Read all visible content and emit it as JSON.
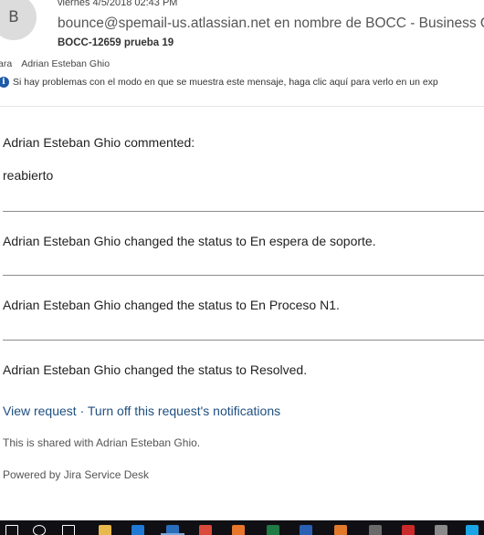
{
  "email": {
    "avatar_letter": "B",
    "date": "viernes 4/5/2018 02:43 PM",
    "sender": "bounce@spemail-us.atlassian.net en nombre de BOCC - Business Operat",
    "subject": "BOCC-12659 prueba 19",
    "to_label": "ara",
    "to_recipient": "Adrian Esteban Ghio",
    "info_text": "Si hay problemas con el modo en que se muestra este mensaje, haga clic aquí para verlo en un exp"
  },
  "body": {
    "comment_header": "Adrian Esteban Ghio commented:",
    "comment_text": "reabierto",
    "status_changes": [
      "Adrian Esteban Ghio changed the status to En espera de soporte.",
      "Adrian Esteban Ghio changed the status to En Proceso N1.",
      "Adrian Esteban Ghio changed the status to Resolved."
    ],
    "view_request": "View request",
    "separator": "·",
    "turn_off": "Turn off this request's notifications",
    "shared_with": "This is shared with Adrian Esteban Ghio.",
    "powered_by": "Powered by Jira Service Desk"
  },
  "taskbar": {
    "icons": [
      {
        "name": "windows-start-icon",
        "color": "#ffffff"
      },
      {
        "name": "search-icon",
        "color": "#ffffff"
      },
      {
        "name": "task-view-icon",
        "color": "#ffffff"
      },
      {
        "name": "file-explorer-icon",
        "color": "#e8b84a"
      },
      {
        "name": "edge-icon",
        "color": "#1f7ad6"
      },
      {
        "name": "outlook-icon",
        "color": "#2a6ebb"
      },
      {
        "name": "chrome-icon",
        "color": "#d94a3a"
      },
      {
        "name": "firefox-icon",
        "color": "#e8762b"
      },
      {
        "name": "excel-icon",
        "color": "#1f7a43"
      },
      {
        "name": "word-icon",
        "color": "#2b5fb3"
      },
      {
        "name": "sublime-icon",
        "color": "#e07a2a"
      },
      {
        "name": "app-icon",
        "color": "#6a6a6a"
      },
      {
        "name": "filezilla-icon",
        "color": "#c92a2a"
      },
      {
        "name": "photo-icon",
        "color": "#8a8a8a"
      },
      {
        "name": "skype-icon",
        "color": "#1aa4e6"
      },
      {
        "name": "app-icon-2",
        "color": "#3a6fd0"
      }
    ]
  }
}
